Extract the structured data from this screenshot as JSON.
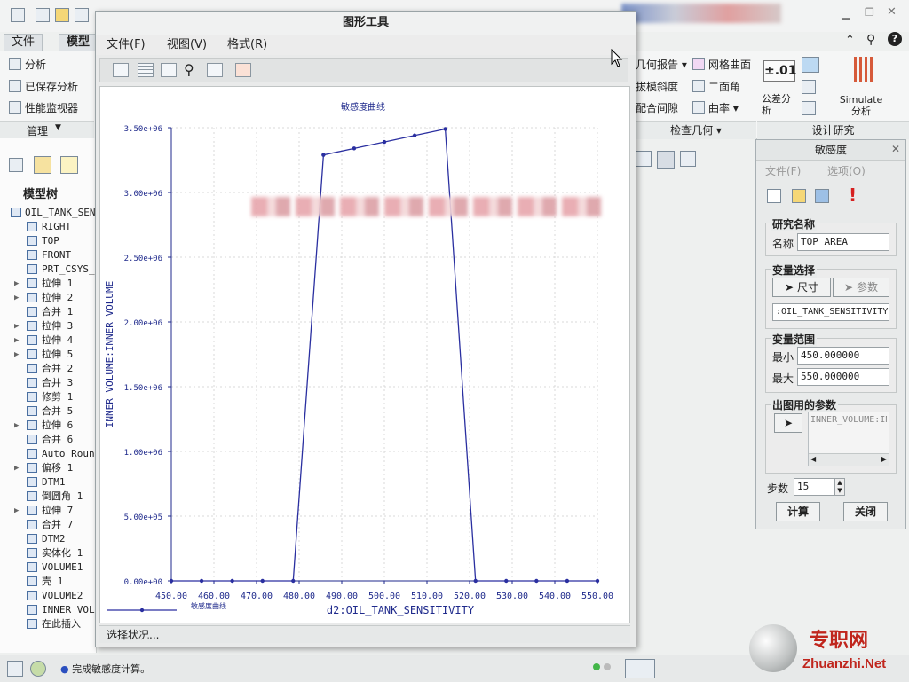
{
  "app": {
    "menu": {
      "file": "文件",
      "model": "模型"
    },
    "ribbon": {
      "left_items": [
        "分析",
        "已保存分析",
        "性能监视器"
      ],
      "manage": "管理",
      "right_items": [
        "几何报告",
        "网格曲面",
        "拔模斜度",
        "二面角",
        "配合间隙",
        "曲率"
      ],
      "tolerance_icon": "±.01",
      "tolerance_label": "公差分析",
      "simulate_label": "Simulate",
      "simulate_sub": "分析",
      "inspect_geometry": "检查几何",
      "design_study": "设计研究"
    },
    "tree": {
      "title": "模型树",
      "items": [
        {
          "label": "OIL_TANK_SENS",
          "expand": ""
        },
        {
          "label": "RIGHT",
          "expand": ""
        },
        {
          "label": "TOP",
          "expand": ""
        },
        {
          "label": "FRONT",
          "expand": ""
        },
        {
          "label": "PRT_CSYS_D",
          "expand": ""
        },
        {
          "label": "拉伸 1",
          "expand": "▶"
        },
        {
          "label": "拉伸 2",
          "expand": "▶"
        },
        {
          "label": "合并 1",
          "expand": ""
        },
        {
          "label": "拉伸 3",
          "expand": "▶"
        },
        {
          "label": "拉伸 4",
          "expand": "▶"
        },
        {
          "label": "拉伸 5",
          "expand": "▶"
        },
        {
          "label": "合并 2",
          "expand": ""
        },
        {
          "label": "合并 3",
          "expand": ""
        },
        {
          "label": "修剪 1",
          "expand": ""
        },
        {
          "label": "合并 5",
          "expand": ""
        },
        {
          "label": "拉伸 6",
          "expand": "▶"
        },
        {
          "label": "合并 6",
          "expand": ""
        },
        {
          "label": "Auto Round",
          "expand": ""
        },
        {
          "label": "偏移 1",
          "expand": "▶"
        },
        {
          "label": "DTM1",
          "expand": ""
        },
        {
          "label": "倒圆角 1",
          "expand": ""
        },
        {
          "label": "拉伸 7",
          "expand": "▶"
        },
        {
          "label": "合并 7",
          "expand": ""
        },
        {
          "label": "DTM2",
          "expand": ""
        },
        {
          "label": "实体化 1",
          "expand": ""
        },
        {
          "label": "VOLUME1",
          "expand": ""
        },
        {
          "label": "壳 1",
          "expand": ""
        },
        {
          "label": "VOLUME2",
          "expand": ""
        },
        {
          "label": "INNER_VOLU",
          "expand": ""
        },
        {
          "label": "在此插入",
          "expand": ""
        }
      ]
    },
    "status": "完成敏感度计算。"
  },
  "graph_window": {
    "title": "图形工具",
    "menu": [
      "文件(F)",
      "视图(V)",
      "格式(R)"
    ],
    "status": "选择状况..."
  },
  "sensitivity": {
    "title": "敏感度",
    "menu": [
      "文件(F)",
      "选项(O)"
    ],
    "study_name_group": "研究名称",
    "name_label": "名称",
    "name_value": "TOP_AREA",
    "variable_group": "变量选择",
    "dim_button": "尺寸",
    "param_button": "参数",
    "variable_value": ":OIL_TANK_SENSITIVITY",
    "range_group": "变量范围",
    "min_label": "最小",
    "min_value": "450.000000",
    "max_label": "最大",
    "max_value": "550.000000",
    "plot_params_group": "出图用的参数",
    "plot_param_item": "INNER_VOLUME:IN",
    "steps_label": "步数",
    "steps_value": "15",
    "compute_button": "计算",
    "close_button": "关闭"
  },
  "watermark": {
    "cn": "专职网",
    "url": "Zhuanzhi.Net"
  },
  "chart_data": {
    "type": "line",
    "title": "敏感度曲线",
    "xlabel": "d2:OIL_TANK_SENSITIVITY",
    "ylabel": "INNER_VOLUME:INNER_VOLUME",
    "xlim": [
      450,
      550
    ],
    "ylim": [
      0,
      3500000
    ],
    "x_ticks": [
      "450.00",
      "460.00",
      "470.00",
      "480.00",
      "490.00",
      "500.00",
      "510.00",
      "520.00",
      "530.00",
      "540.00",
      "550.00"
    ],
    "y_ticks": [
      "0.00e+00",
      "5.00e+05",
      "1.00e+06",
      "1.50e+06",
      "2.00e+06",
      "2.50e+06",
      "3.00e+06",
      "3.50e+06"
    ],
    "legend": "敏感度曲线",
    "grid": true,
    "series": [
      {
        "name": "敏感度曲线",
        "x": [
          450.0,
          457.1,
          464.3,
          471.4,
          478.6,
          485.7,
          492.9,
          500.0,
          507.1,
          514.3,
          521.4,
          528.6,
          535.7,
          542.9,
          550.0
        ],
        "y": [
          0,
          0,
          0,
          0,
          0,
          3290000,
          3340000,
          3390000,
          3440000,
          3490000,
          0,
          0,
          0,
          0,
          0
        ]
      }
    ]
  }
}
